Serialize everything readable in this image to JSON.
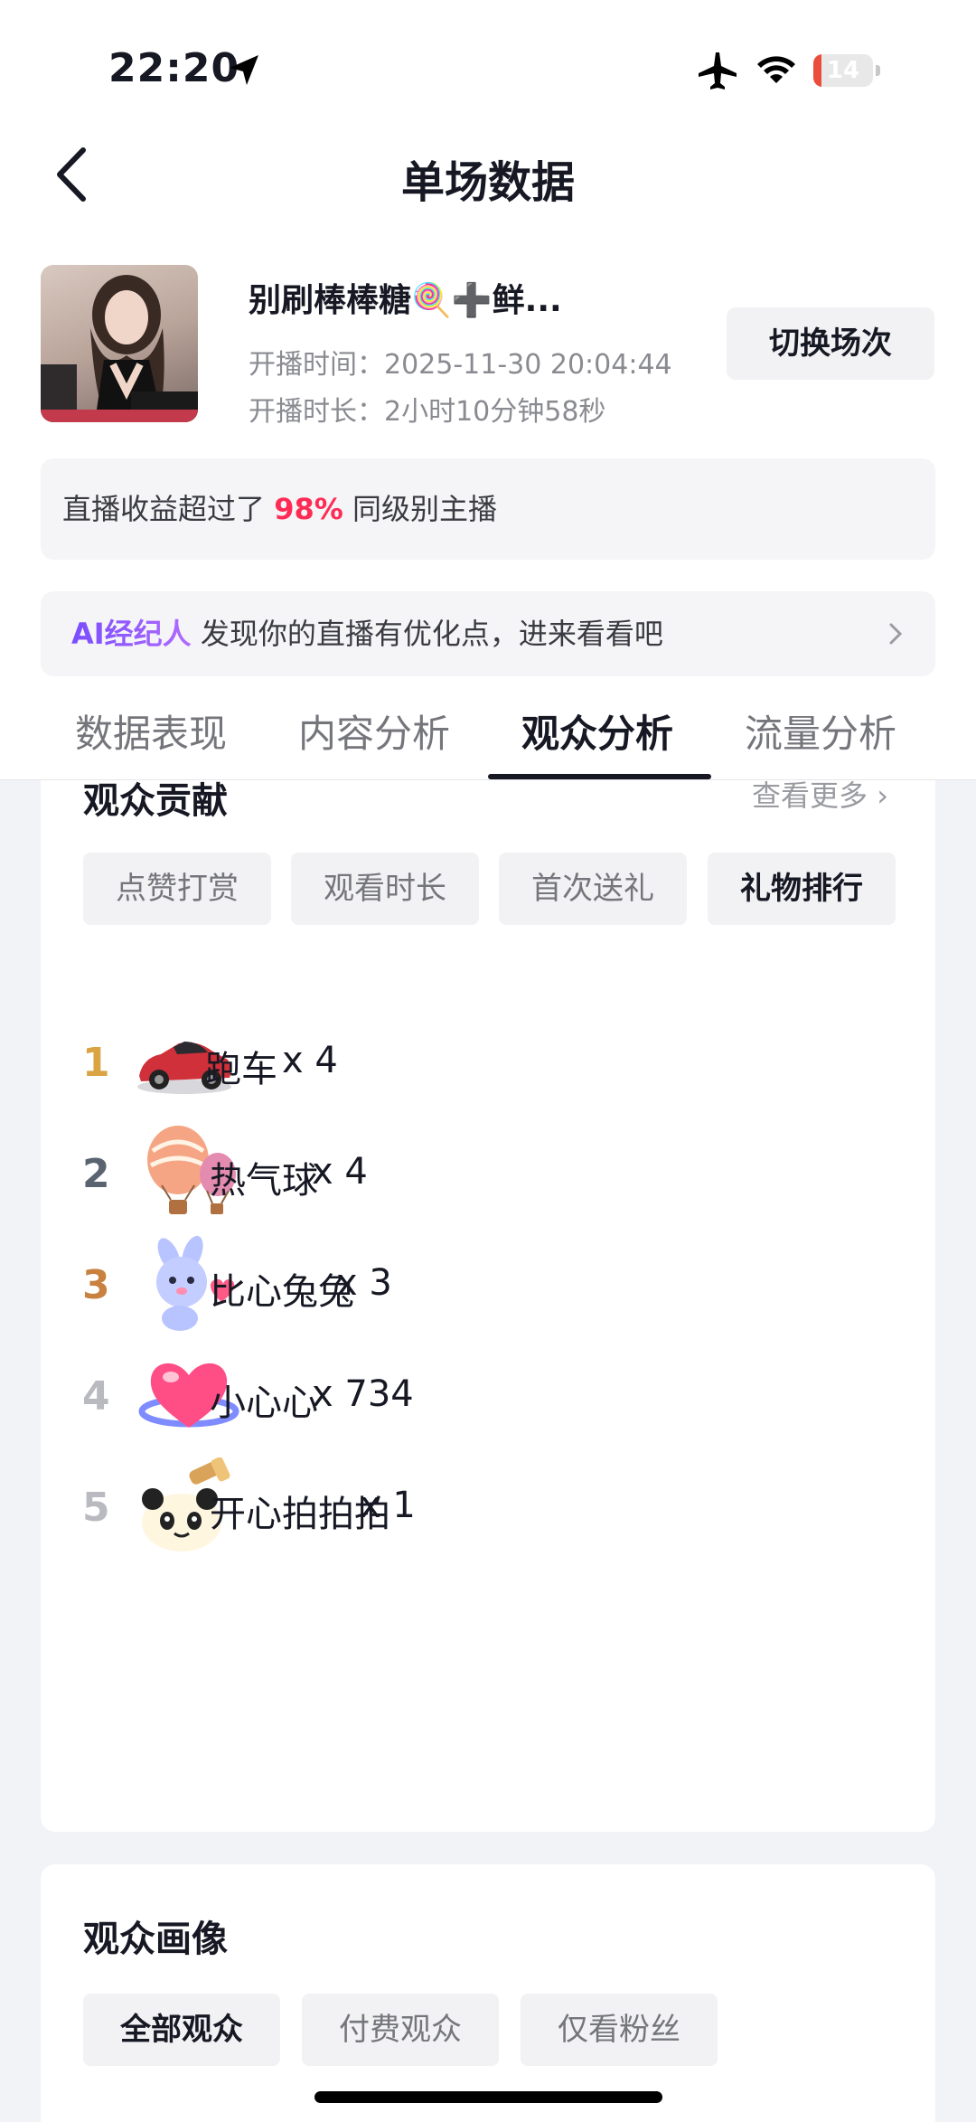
{
  "status_bar": {
    "time": "22:20",
    "battery": "14",
    "battery_level": 0.14,
    "battery_color": "#eb4d3d"
  },
  "header": {
    "title": "单场数据"
  },
  "session": {
    "name": "别刷棒棒糖🍭➕鲜...",
    "start_time": "开播时间：2025-11-30 20:04:44",
    "duration": "开播时长：2小时10分钟58秒",
    "switch_label": "切换场次"
  },
  "rank_banner": {
    "prefix": "直播收益超过了 ",
    "percent": "98%",
    "suffix": " 同级别主播",
    "accent": "#fe2c55"
  },
  "ai_banner": {
    "tag": "AI经纪人",
    "text": " 发现你的直播有优化点，进来看看吧"
  },
  "tabs": [
    {
      "label": "数据表现",
      "active": false
    },
    {
      "label": "内容分析",
      "active": false
    },
    {
      "label": "观众分析",
      "active": true
    },
    {
      "label": "流量分析",
      "active": false
    }
  ],
  "contribution": {
    "title": "观众贡献",
    "see_more": "查看更多",
    "chips": [
      {
        "label": "点赞打赏",
        "active": false
      },
      {
        "label": "观看时长",
        "active": false
      },
      {
        "label": "首次送礼",
        "active": false
      },
      {
        "label": "礼物排行",
        "active": true
      }
    ],
    "gifts": [
      {
        "rank": "1",
        "name": "跑车",
        "count": "x 4",
        "icon": "sports-car-icon",
        "rank_color": "#d9a441"
      },
      {
        "rank": "2",
        "name": "热气球",
        "count": "x 4",
        "icon": "hot-air-balloon-icon",
        "rank_color": "#5a6470"
      },
      {
        "rank": "3",
        "name": "比心兔兔",
        "count": "x 3",
        "icon": "heart-bunny-icon",
        "rank_color": "#c8813f"
      },
      {
        "rank": "4",
        "name": "小心心",
        "count": "x 734",
        "icon": "small-heart-icon",
        "rank_color": "#b9bac0"
      },
      {
        "rank": "5",
        "name": "开心拍拍拍",
        "count": "x 1",
        "icon": "happy-panda-icon",
        "rank_color": "#b9bac0"
      }
    ]
  },
  "portrait": {
    "title": "观众画像",
    "chips": [
      {
        "label": "全部观众",
        "active": true
      },
      {
        "label": "付费观众",
        "active": false
      },
      {
        "label": "仅看粉丝",
        "active": false
      }
    ]
  }
}
